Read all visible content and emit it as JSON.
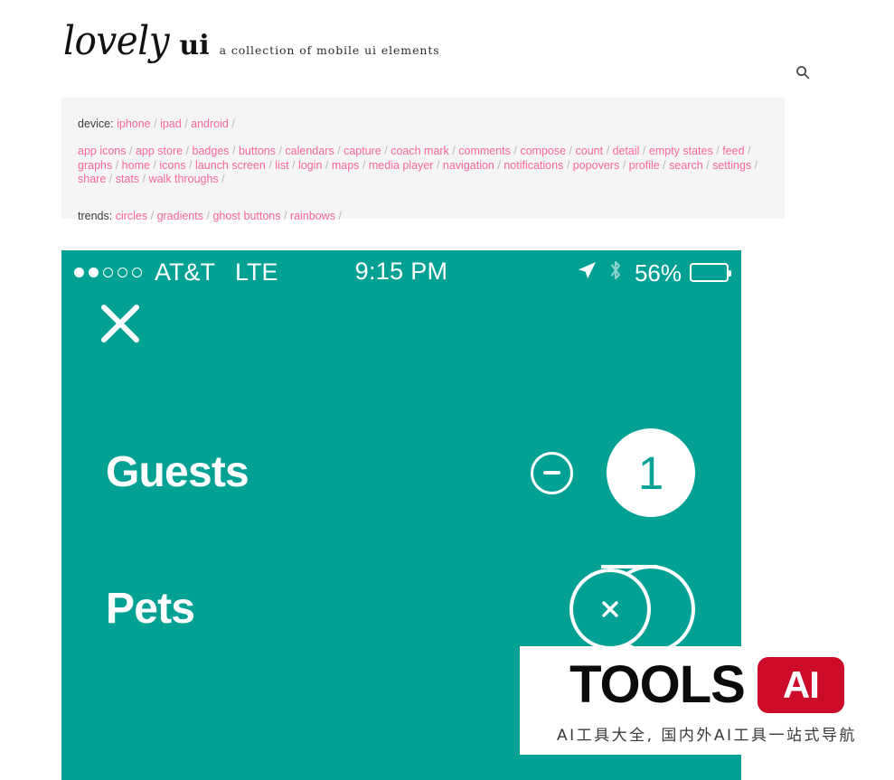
{
  "site": {
    "logo_script": "lovely",
    "logo_bold": "ui",
    "tagline": "a collection of mobile ui elements",
    "search_icon": "search-icon"
  },
  "tags": {
    "device_label": "device:",
    "devices": [
      "iphone",
      "ipad",
      "android"
    ],
    "categories": [
      "app icons",
      "app store",
      "badges",
      "buttons",
      "calendars",
      "capture",
      "coach mark",
      "comments",
      "compose",
      "count",
      "detail",
      "empty states",
      "feed",
      "graphs",
      "home",
      "icons",
      "launch screen",
      "list",
      "login",
      "maps",
      "media player",
      "navigation",
      "notifications",
      "popovers",
      "profile",
      "search",
      "settings",
      "share",
      "stats",
      "walk throughs"
    ],
    "trends_label": "trends:",
    "trends": [
      "circles",
      "gradients",
      "ghost buttons",
      "rainbows"
    ],
    "separator": "/",
    "link_color": "#f9679d"
  },
  "phone": {
    "background_color": "#03a194",
    "status_bar": {
      "signal_dots_filled": 2,
      "signal_dots_total": 5,
      "carrier": "AT&T",
      "network": "LTE",
      "time": "9:15 PM",
      "location_icon": "location-arrow-icon",
      "bluetooth_icon": "bluetooth-icon",
      "battery_percent": "56%",
      "battery_level": 56,
      "battery_color": "#ffd300"
    },
    "close_icon": "close-icon",
    "rows": [
      {
        "label": "Guests",
        "count": "1",
        "decrement_icon": "minus-icon",
        "state": "counter"
      },
      {
        "label": "Pets",
        "count": "",
        "clear_icon": "close-small-icon",
        "state": "morphing"
      }
    ]
  },
  "watermark": {
    "title": "TOOLS",
    "badge": "AI",
    "subtitle": "AI工具大全, 国内外AI工具一站式导航",
    "badge_color": "#cc0a2a"
  }
}
